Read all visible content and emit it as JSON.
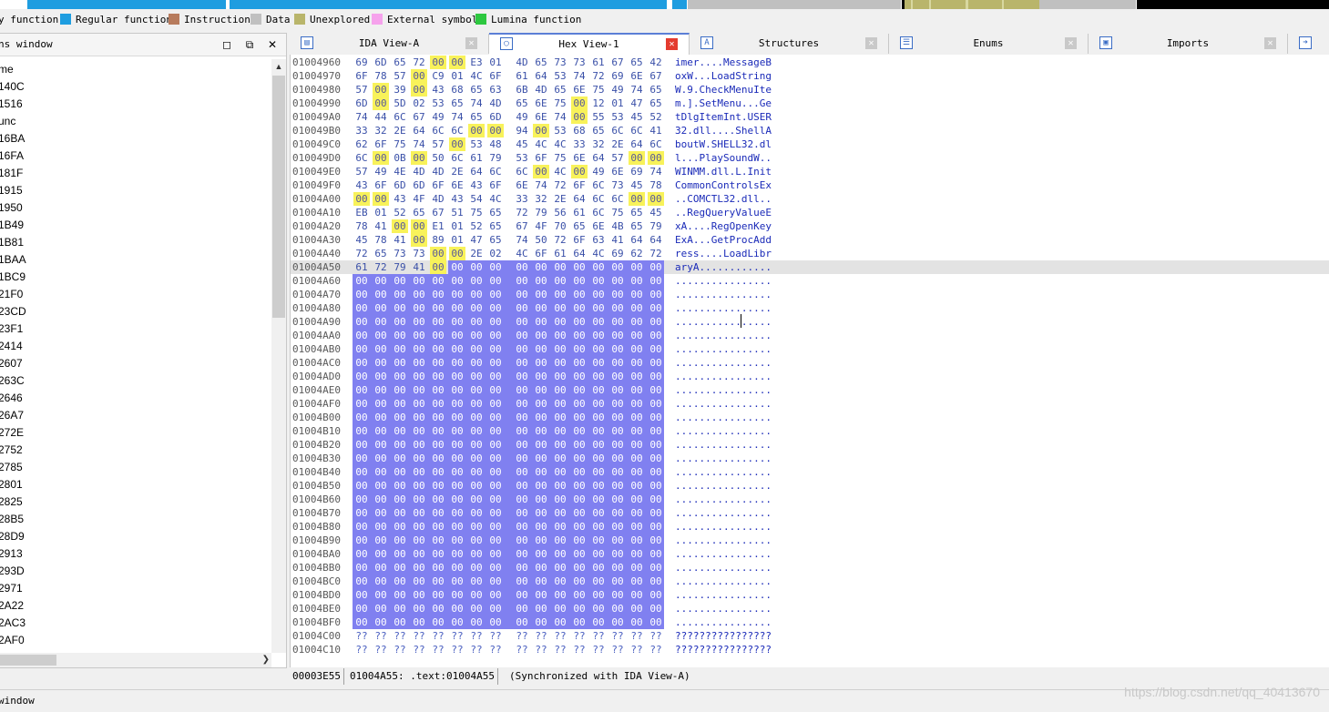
{
  "legend": [
    {
      "label": "y function",
      "color": "#ffffff"
    },
    {
      "label": "Regular function",
      "color": "#1e9de0"
    },
    {
      "label": "Instruction",
      "color": "#b77b5d"
    },
    {
      "label": "Data",
      "color": "#c0c0c0"
    },
    {
      "label": "Unexplored",
      "color": "#b9b56b"
    },
    {
      "label": "External symbol",
      "color": "#f6a2ec"
    },
    {
      "label": "Lumina function",
      "color": "#2ec840"
    }
  ],
  "left_panel": {
    "title": "ns window",
    "column_header": "me",
    "functions": [
      "140C",
      "1516",
      "unc",
      "16BA",
      "16FA",
      "181F",
      "1915",
      "1950",
      "1B49",
      "1B81",
      "1BAA",
      "1BC9",
      "21F0",
      "23CD",
      "23F1",
      "2414",
      "2607",
      "263C",
      "2646",
      "26A7",
      "272E",
      "2752",
      "2785",
      "2801",
      "2825",
      "28B5",
      "28D9",
      "2913",
      "293D",
      "2971",
      "2A22",
      "2AC3",
      "2AF0"
    ]
  },
  "tabs": [
    {
      "label": "IDA View-A",
      "icon": "ida-view-icon",
      "active": false
    },
    {
      "label": "Hex View-1",
      "icon": "hex-view-icon",
      "active": true
    },
    {
      "label": "Structures",
      "icon": "structures-icon",
      "active": false
    },
    {
      "label": "Enums",
      "icon": "enums-icon",
      "active": false
    },
    {
      "label": "Imports",
      "icon": "imports-icon",
      "active": false
    }
  ],
  "hex_rows": [
    {
      "addr": "01004960",
      "bytes": "69 6D 65 72 00 00 E3 01 4D 65 73 73 61 67 65 42",
      "ascii": "imer....MessageB"
    },
    {
      "addr": "01004970",
      "bytes": "6F 78 57 00 C9 01 4C 6F 61 64 53 74 72 69 6E 67",
      "ascii": "oxW...LoadString"
    },
    {
      "addr": "01004980",
      "bytes": "57 00 39 00 43 68 65 63 6B 4D 65 6E 75 49 74 65",
      "ascii": "W.9.CheckMenuIte"
    },
    {
      "addr": "01004990",
      "bytes": "6D 00 5D 02 53 65 74 4D 65 6E 75 00 12 01 47 65",
      "ascii": "m.].SetMenu...Ge"
    },
    {
      "addr": "010049A0",
      "bytes": "74 44 6C 67 49 74 65 6D 49 6E 74 00 55 53 45 52",
      "ascii": "tDlgItemInt.USER"
    },
    {
      "addr": "010049B0",
      "bytes": "33 32 2E 64 6C 6C 00 00 94 00 53 68 65 6C 6C 41",
      "ascii": "32.dll....ShellA"
    },
    {
      "addr": "010049C0",
      "bytes": "62 6F 75 74 57 00 53 48 45 4C 4C 33 32 2E 64 6C",
      "ascii": "boutW.SHELL32.dl"
    },
    {
      "addr": "010049D0",
      "bytes": "6C 00 0B 00 50 6C 61 79 53 6F 75 6E 64 57 00 00",
      "ascii": "l...PlaySoundW.."
    },
    {
      "addr": "010049E0",
      "bytes": "57 49 4E 4D 4D 2E 64 6C 6C 00 4C 00 49 6E 69 74",
      "ascii": "WINMM.dll.L.Init"
    },
    {
      "addr": "010049F0",
      "bytes": "43 6F 6D 6D 6F 6E 43 6F 6E 74 72 6F 6C 73 45 78",
      "ascii": "CommonControlsEx"
    },
    {
      "addr": "01004A00",
      "bytes": "00 00 43 4F 4D 43 54 4C 33 32 2E 64 6C 6C 00 00",
      "ascii": "..COMCTL32.dll.."
    },
    {
      "addr": "01004A10",
      "bytes": "EB 01 52 65 67 51 75 65 72 79 56 61 6C 75 65 45",
      "ascii": "..RegQueryValueE"
    },
    {
      "addr": "01004A20",
      "bytes": "78 41 00 00 E1 01 52 65 67 4F 70 65 6E 4B 65 79",
      "ascii": "xA....RegOpenKey"
    },
    {
      "addr": "01004A30",
      "bytes": "45 78 41 00 89 01 47 65 74 50 72 6F 63 41 64 64",
      "ascii": "ExA...GetProcAdd"
    },
    {
      "addr": "01004A40",
      "bytes": "72 65 73 73 00 00 2E 02 4C 6F 61 64 4C 69 62 72",
      "ascii": "ress....LoadLibr"
    },
    {
      "addr": "01004A50",
      "bytes": "61 72 79 41 00 00 00 00 00 00 00 00 00 00 00 00",
      "ascii": "aryA............"
    },
    {
      "addr": "01004A60",
      "bytes": "00 00 00 00 00 00 00 00 00 00 00 00 00 00 00 00",
      "ascii": "................"
    },
    {
      "addr": "01004A70",
      "bytes": "00 00 00 00 00 00 00 00 00 00 00 00 00 00 00 00",
      "ascii": "................"
    },
    {
      "addr": "01004A80",
      "bytes": "00 00 00 00 00 00 00 00 00 00 00 00 00 00 00 00",
      "ascii": "................"
    },
    {
      "addr": "01004A90",
      "bytes": "00 00 00 00 00 00 00 00 00 00 00 00 00 00 00 00",
      "ascii": "................"
    },
    {
      "addr": "01004AA0",
      "bytes": "00 00 00 00 00 00 00 00 00 00 00 00 00 00 00 00",
      "ascii": "................"
    },
    {
      "addr": "01004AB0",
      "bytes": "00 00 00 00 00 00 00 00 00 00 00 00 00 00 00 00",
      "ascii": "................"
    },
    {
      "addr": "01004AC0",
      "bytes": "00 00 00 00 00 00 00 00 00 00 00 00 00 00 00 00",
      "ascii": "................"
    },
    {
      "addr": "01004AD0",
      "bytes": "00 00 00 00 00 00 00 00 00 00 00 00 00 00 00 00",
      "ascii": "................"
    },
    {
      "addr": "01004AE0",
      "bytes": "00 00 00 00 00 00 00 00 00 00 00 00 00 00 00 00",
      "ascii": "................"
    },
    {
      "addr": "01004AF0",
      "bytes": "00 00 00 00 00 00 00 00 00 00 00 00 00 00 00 00",
      "ascii": "................"
    },
    {
      "addr": "01004B00",
      "bytes": "00 00 00 00 00 00 00 00 00 00 00 00 00 00 00 00",
      "ascii": "................"
    },
    {
      "addr": "01004B10",
      "bytes": "00 00 00 00 00 00 00 00 00 00 00 00 00 00 00 00",
      "ascii": "................"
    },
    {
      "addr": "01004B20",
      "bytes": "00 00 00 00 00 00 00 00 00 00 00 00 00 00 00 00",
      "ascii": "................"
    },
    {
      "addr": "01004B30",
      "bytes": "00 00 00 00 00 00 00 00 00 00 00 00 00 00 00 00",
      "ascii": "................"
    },
    {
      "addr": "01004B40",
      "bytes": "00 00 00 00 00 00 00 00 00 00 00 00 00 00 00 00",
      "ascii": "................"
    },
    {
      "addr": "01004B50",
      "bytes": "00 00 00 00 00 00 00 00 00 00 00 00 00 00 00 00",
      "ascii": "................"
    },
    {
      "addr": "01004B60",
      "bytes": "00 00 00 00 00 00 00 00 00 00 00 00 00 00 00 00",
      "ascii": "................"
    },
    {
      "addr": "01004B70",
      "bytes": "00 00 00 00 00 00 00 00 00 00 00 00 00 00 00 00",
      "ascii": "................"
    },
    {
      "addr": "01004B80",
      "bytes": "00 00 00 00 00 00 00 00 00 00 00 00 00 00 00 00",
      "ascii": "................"
    },
    {
      "addr": "01004B90",
      "bytes": "00 00 00 00 00 00 00 00 00 00 00 00 00 00 00 00",
      "ascii": "................"
    },
    {
      "addr": "01004BA0",
      "bytes": "00 00 00 00 00 00 00 00 00 00 00 00 00 00 00 00",
      "ascii": "................"
    },
    {
      "addr": "01004BB0",
      "bytes": "00 00 00 00 00 00 00 00 00 00 00 00 00 00 00 00",
      "ascii": "................"
    },
    {
      "addr": "01004BC0",
      "bytes": "00 00 00 00 00 00 00 00 00 00 00 00 00 00 00 00",
      "ascii": "................"
    },
    {
      "addr": "01004BD0",
      "bytes": "00 00 00 00 00 00 00 00 00 00 00 00 00 00 00 00",
      "ascii": "................"
    },
    {
      "addr": "01004BE0",
      "bytes": "00 00 00 00 00 00 00 00 00 00 00 00 00 00 00 00",
      "ascii": "................"
    },
    {
      "addr": "01004BF0",
      "bytes": "00 00 00 00 00 00 00 00 00 00 00 00 00 00 00 00",
      "ascii": "................"
    },
    {
      "addr": "01004C00",
      "bytes": "?? ?? ?? ?? ?? ?? ?? ?? ?? ?? ?? ?? ?? ?? ?? ??",
      "ascii": "????????????????"
    },
    {
      "addr": "01004C10",
      "bytes": "?? ?? ?? ?? ?? ?? ?? ?? ?? ?? ?? ?? ?? ?? ?? ??",
      "ascii": "????????????????"
    }
  ],
  "selection": {
    "start": "01004A54",
    "end": "01004BFF",
    "cursor": "01004A55"
  },
  "status": {
    "offset": "00003E55",
    "location": "01004A55: .text:01004A55",
    "sync": "(Synchronized with IDA View-A)"
  },
  "bottom_title": "window",
  "watermark": "https://blog.csdn.net/qq_40413670"
}
